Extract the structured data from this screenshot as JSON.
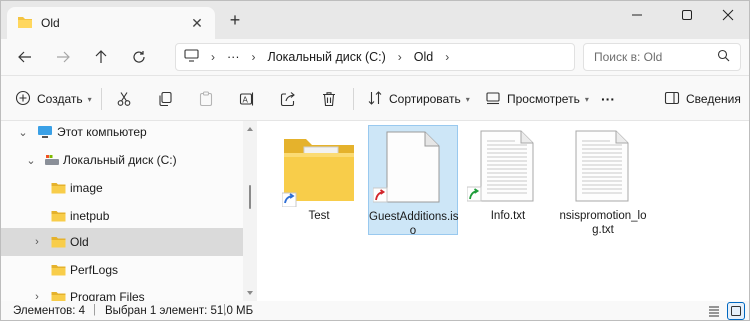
{
  "window": {
    "tab_title": "Old",
    "new_tab": "+",
    "close_tab": "✕"
  },
  "nav": {
    "address": {
      "ellipsis": "···",
      "crumbs": [
        "Локальный диск (C:)",
        "Old"
      ]
    },
    "search_placeholder": "Поиск в: Old"
  },
  "commands": {
    "create": "Создать",
    "sort": "Сортировать",
    "view": "Просмотреть",
    "more": "···",
    "details": "Сведения"
  },
  "tree": [
    {
      "label": "Этот компьютер",
      "icon": "computer-icon",
      "expanded": true
    },
    {
      "label": "Локальный диск (C:)",
      "icon": "drive-icon",
      "expanded": true
    },
    {
      "label": "image",
      "icon": "folder-icon"
    },
    {
      "label": "inetpub",
      "icon": "folder-icon"
    },
    {
      "label": "Old",
      "icon": "folder-icon",
      "selected": true
    },
    {
      "label": "PerfLogs",
      "icon": "folder-icon"
    },
    {
      "label": "Program Files",
      "icon": "folder-icon"
    }
  ],
  "files": [
    {
      "name": "Test",
      "icon": "folder-shortcut-icon"
    },
    {
      "name": "GuestAdditions.iso",
      "name_line1": "GuestAdditions.is",
      "name_line2": "o",
      "icon": "iso-shortcut-icon",
      "selected": true
    },
    {
      "name": "Info.txt",
      "icon": "text-file-shortcut-icon"
    },
    {
      "name": "nsispromotion_log.txt",
      "name_line1": "nsispromotion_lo",
      "name_line2": "g.txt",
      "icon": "text-file-icon"
    }
  ],
  "status": {
    "items_count": "Элементов: 4",
    "selection": "Выбран 1 элемент: 51,0 МБ"
  },
  "colors": {
    "folder": "#f4c441",
    "selection": "#cde6f7",
    "accent": "#0067c0"
  }
}
